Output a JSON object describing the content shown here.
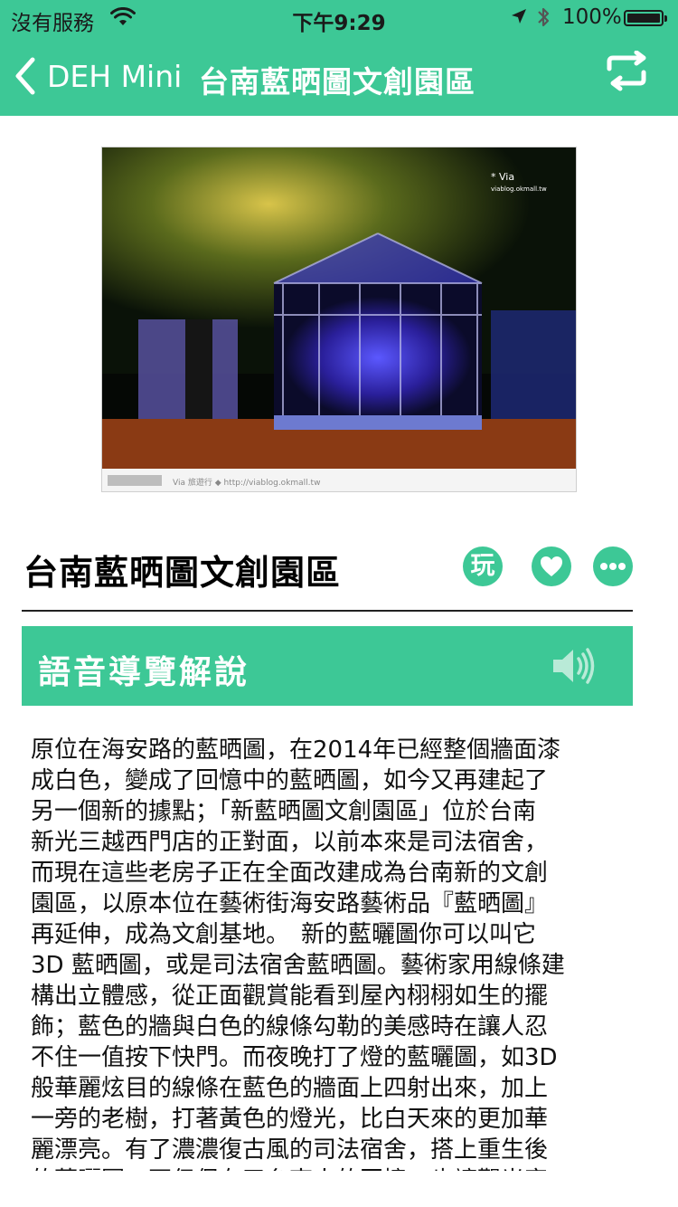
{
  "status_bar": {
    "carrier": "沒有服務",
    "time": "下午9:29",
    "battery": "100%",
    "battery_level": 1.0
  },
  "nav": {
    "back_label": "DEH Mini",
    "title": "台南藍晒圖文創園區",
    "icons": [
      "chevron-left-icon",
      "switch-icon"
    ]
  },
  "place": {
    "title": "台南藍晒圖文創園區",
    "play_label": "玩",
    "photo": {
      "watermark_top": "* Via",
      "watermark_url": "viablog.okmall.tw",
      "caption_strip": "Via 旅遊行 ◆ http://viablog.okmall.tw"
    }
  },
  "audio": {
    "label": "語音導覽解說",
    "icon": "speaker-icon"
  },
  "description": "原位在海安路的藍晒圖，在2014年已經整個牆面漆\n成白色，變成了回憶中的藍晒圖，如今又再建起了\n另一個新的據點；「新藍晒圖文創園區」位於台南\n新光三越西門店的正對面，以前本來是司法宿舍，\n而現在這些老房子正在全面改建成為台南新的文創\n園區，以原本位在藝術街海安路藝術品『藍晒圖』\n再延伸，成為文創基地。　新的藍曬圖你可以叫它\n3D 藍晒圖，或是司法宿舍藍晒圖。藝術家用線條建\n構出立體感，從正面觀賞能看到屋內栩栩如生的擺\n飾；藍色的牆與白色的線條勾勒的美感時在讓人忍\n不住一值按下快門。而夜晚打了燈的藍曬圖，如3D\n般華麗炫目的線條在藍色的牆面上四射出來，加上\n一旁的老樹，打著黃色的燈光，比白天來的更加華\n麗漂亮。有了濃濃復古風的司法宿舍，搭上重生後\n的藍曬圖，不但保有了台南人的回憶，也讓觀光客",
  "colors": {
    "accent": "#3dc896",
    "nav_text": "#ffffff",
    "status_text": "#1a1a1a"
  }
}
